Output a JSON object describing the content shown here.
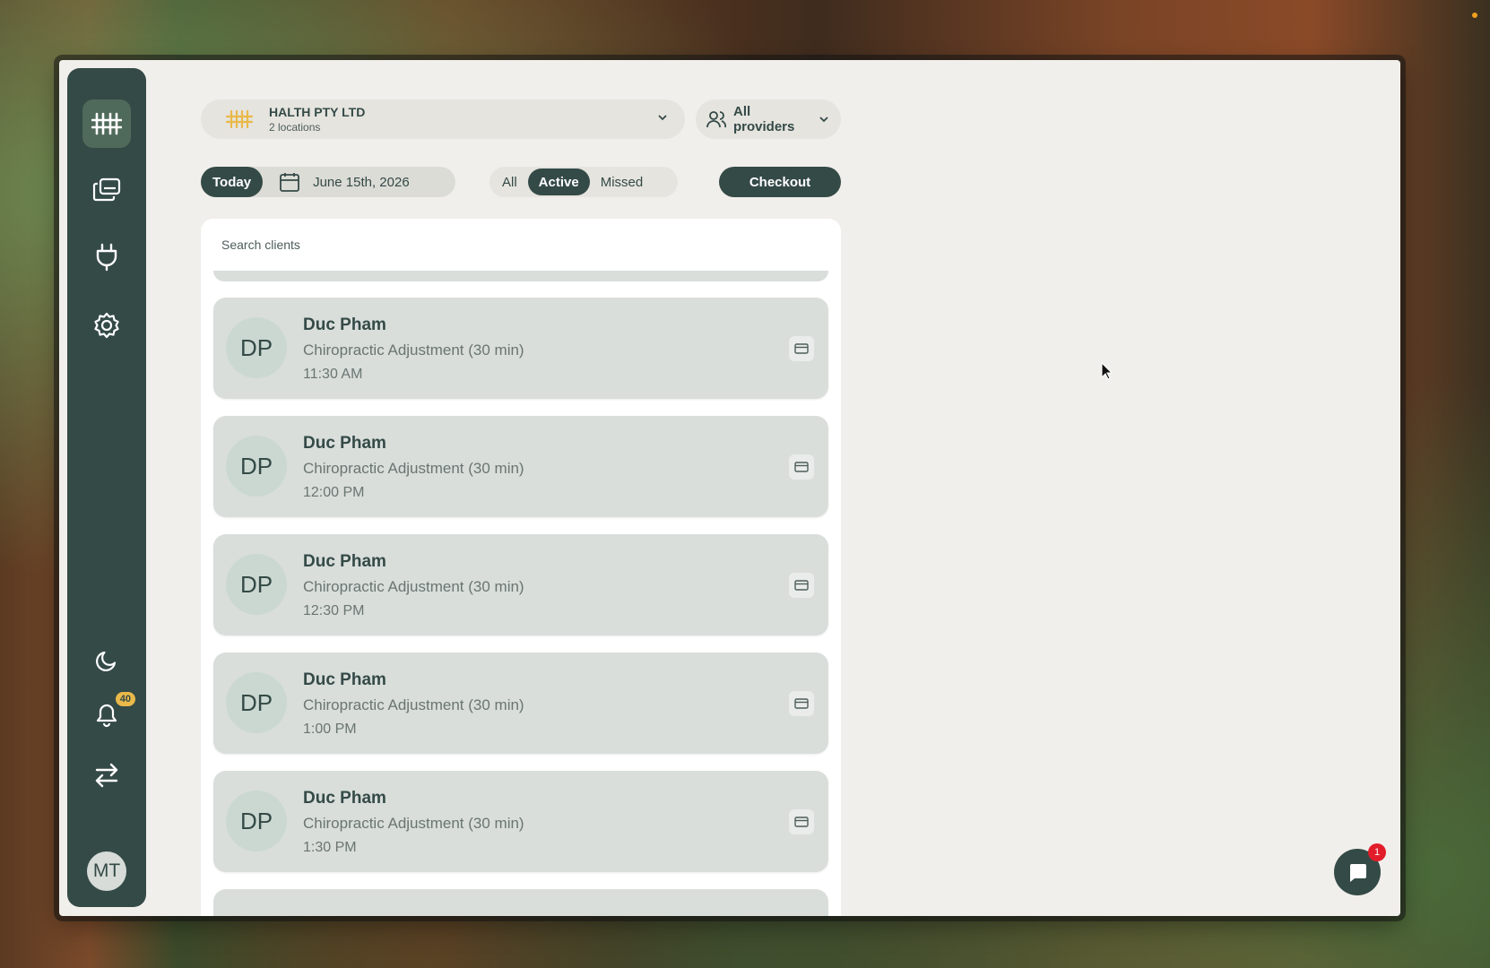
{
  "organization": {
    "name": "HALTH PTY LTD",
    "subtitle": "2 locations"
  },
  "providers": {
    "label": "All providers"
  },
  "date_bar": {
    "today_label": "Today",
    "date": "June 15th, 2026"
  },
  "filters": [
    {
      "label": "All",
      "active": false
    },
    {
      "label": "Active",
      "active": true
    },
    {
      "label": "Missed",
      "active": false
    }
  ],
  "checkout_label": "Checkout",
  "search": {
    "placeholder": "Search clients"
  },
  "appointments": [
    {
      "initials": "DP",
      "name": "Duc Pham",
      "service": "Chiropractic Adjustment (30 min)",
      "time": "11:30 AM"
    },
    {
      "initials": "DP",
      "name": "Duc Pham",
      "service": "Chiropractic Adjustment (30 min)",
      "time": "12:00 PM"
    },
    {
      "initials": "DP",
      "name": "Duc Pham",
      "service": "Chiropractic Adjustment (30 min)",
      "time": "12:30 PM"
    },
    {
      "initials": "DP",
      "name": "Duc Pham",
      "service": "Chiropractic Adjustment (30 min)",
      "time": "1:00 PM"
    },
    {
      "initials": "DP",
      "name": "Duc Pham",
      "service": "Chiropractic Adjustment (30 min)",
      "time": "1:30 PM"
    }
  ],
  "sidebar": {
    "top_icons": [
      "logo-icon",
      "appointments-icon",
      "plug-icon",
      "gear-icon"
    ],
    "bottom_icons": [
      "moon-icon",
      "bell-icon",
      "switch-icon"
    ],
    "notification_count": "40",
    "user_initials": "MT"
  },
  "chat": {
    "badge_count": "1"
  },
  "colors": {
    "primary": "#344a47",
    "background": "#f1efeb",
    "card": "#d9dedb",
    "badge_yellow": "#e9b949",
    "badge_red": "#e21c2a"
  }
}
